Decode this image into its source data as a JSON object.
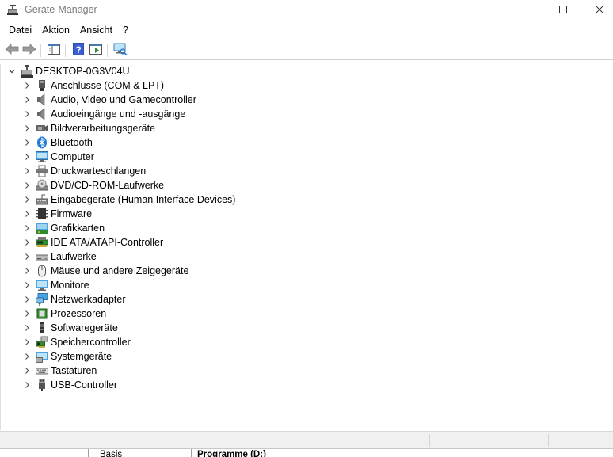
{
  "window": {
    "title": "Geräte-Manager"
  },
  "menu": [
    "Datei",
    "Aktion",
    "Ansicht",
    "?"
  ],
  "tree": {
    "root": "DESKTOP-0G3V04U",
    "categories": [
      {
        "label": "Anschlüsse (COM & LPT)",
        "icon": "port-icon"
      },
      {
        "label": "Audio, Video und Gamecontroller",
        "icon": "speaker-icon"
      },
      {
        "label": "Audioeingänge und -ausgänge",
        "icon": "speaker-icon"
      },
      {
        "label": "Bildverarbeitungsgeräte",
        "icon": "camera-icon"
      },
      {
        "label": "Bluetooth",
        "icon": "bluetooth-icon"
      },
      {
        "label": "Computer",
        "icon": "computer-icon"
      },
      {
        "label": "Druckwarteschlangen",
        "icon": "printer-icon"
      },
      {
        "label": "DVD/CD-ROM-Laufwerke",
        "icon": "disc-icon"
      },
      {
        "label": "Eingabegeräte (Human Interface Devices)",
        "icon": "hid-icon"
      },
      {
        "label": "Firmware",
        "icon": "firmware-icon"
      },
      {
        "label": "Grafikkarten",
        "icon": "display-adapter-icon"
      },
      {
        "label": "IDE ATA/ATAPI-Controller",
        "icon": "ide-controller-icon"
      },
      {
        "label": "Laufwerke",
        "icon": "drive-icon"
      },
      {
        "label": "Mäuse und andere Zeigegeräte",
        "icon": "mouse-icon"
      },
      {
        "label": "Monitore",
        "icon": "monitor-icon"
      },
      {
        "label": "Netzwerkadapter",
        "icon": "network-icon"
      },
      {
        "label": "Prozessoren",
        "icon": "processor-icon"
      },
      {
        "label": "Softwaregeräte",
        "icon": "software-device-icon"
      },
      {
        "label": "Speichercontroller",
        "icon": "storage-controller-icon"
      },
      {
        "label": "Systemgeräte",
        "icon": "system-device-icon"
      },
      {
        "label": "Tastaturen",
        "icon": "keyboard-icon"
      },
      {
        "label": "USB-Controller",
        "icon": "usb-icon"
      }
    ]
  },
  "background_window": {
    "cell_left": "Basis",
    "cell_right": "Programme  (D:)"
  },
  "colors": {
    "accent": "#1e7ad6",
    "title_text": "#7a7a7a",
    "statusbar": "#f0f0f0"
  }
}
